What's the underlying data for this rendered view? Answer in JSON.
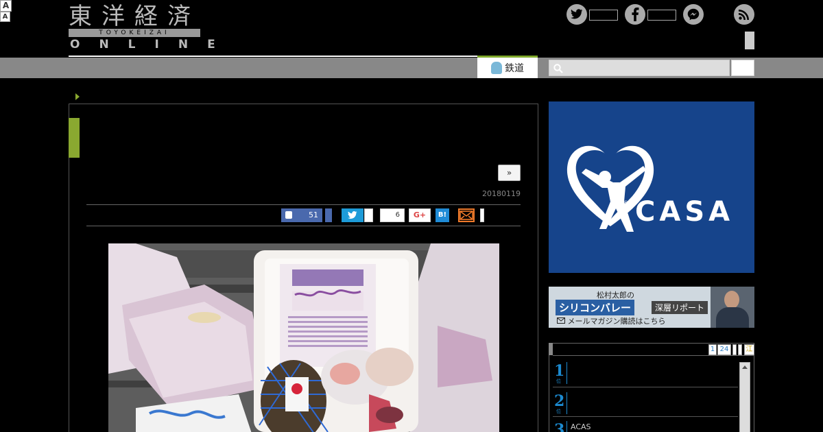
{
  "header": {
    "logo_kanji": "東洋経済",
    "logo_romaji": "TOYOKEIZAI",
    "logo_online": "ONLINE",
    "social": [
      {
        "name": "twitter",
        "glyph": "t"
      },
      {
        "name": "facebook",
        "glyph": "f"
      },
      {
        "name": "messenger",
        "glyph": "~"
      }
    ],
    "nav_tab_label": "鉄道"
  },
  "article": {
    "next_label": "»",
    "date": "20180119",
    "share": {
      "like_count": "51",
      "count_6": "6",
      "gplus_label": "G+",
      "hatena_label": "B!",
      "font_large": "A",
      "font_small": "A"
    }
  },
  "sidebar": {
    "ad_casa": "CASA",
    "ad_casa_reg": "®",
    "ad_sv": {
      "line1": "松村太郎の",
      "line2": "シリコンバレー",
      "line2b": "深層リポート",
      "line3": "メールマガジン購読はこちら"
    },
    "ranking": {
      "pager": [
        "1",
        "24"
      ],
      "pager_end": "江",
      "items": [
        {
          "rank": "1",
          "unit": "位",
          "title": ""
        },
        {
          "rank": "2",
          "unit": "位",
          "title": ""
        },
        {
          "rank": "3",
          "unit": "位",
          "title": "ACAS"
        }
      ]
    }
  },
  "colors": {
    "accent_green": "#8aa830",
    "facebook_blue": "#4a69ad",
    "twitter_blue": "#1d9bd8",
    "casa_blue": "#16448b",
    "rank_blue": "#1c8ad0"
  }
}
